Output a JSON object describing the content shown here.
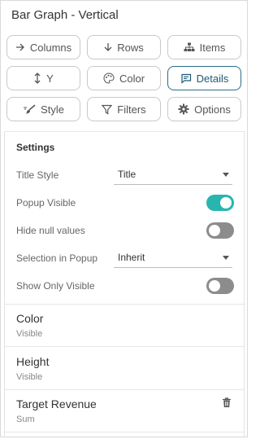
{
  "title": "Bar Graph - Vertical",
  "buttons": [
    {
      "label": "Columns",
      "icon": "arrow-right-icon",
      "active": false
    },
    {
      "label": "Rows",
      "icon": "arrow-down-icon",
      "active": false
    },
    {
      "label": "Items",
      "icon": "hierarchy-icon",
      "active": false
    },
    {
      "label": "Y",
      "icon": "vertical-arrows-icon",
      "active": false
    },
    {
      "label": "Color",
      "icon": "palette-icon",
      "active": false
    },
    {
      "label": "Details",
      "icon": "comment-icon",
      "active": true
    },
    {
      "label": "Style",
      "icon": "brush-icon",
      "active": false
    },
    {
      "label": "Filters",
      "icon": "filter-icon",
      "active": false
    },
    {
      "label": "Options",
      "icon": "gear-icon",
      "active": false
    }
  ],
  "settings": {
    "heading": "Settings",
    "title_style": {
      "label": "Title Style",
      "value": "Title"
    },
    "popup_visible": {
      "label": "Popup Visible",
      "on": true
    },
    "hide_null": {
      "label": "Hide null values",
      "on": false
    },
    "selection_in_popup": {
      "label": "Selection in Popup",
      "value": "Inherit"
    },
    "show_only_visible": {
      "label": "Show Only Visible",
      "on": false
    }
  },
  "items": [
    {
      "title": "Color",
      "sub": "Visible"
    },
    {
      "title": "Height",
      "sub": "Visible"
    },
    {
      "title": "Target Revenue",
      "sub": "Sum"
    }
  ],
  "colors": {
    "toggle_on": "#28b5b0",
    "toggle_off": "#8c8c8c",
    "active_border": "#2b6c87"
  }
}
